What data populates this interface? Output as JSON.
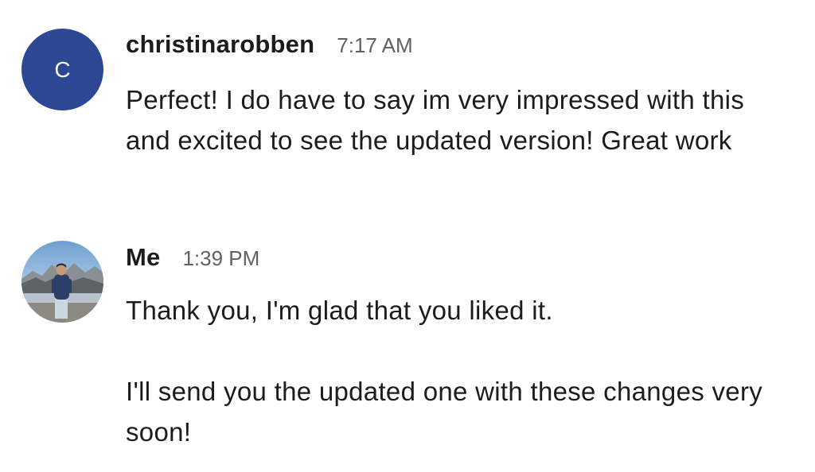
{
  "messages": [
    {
      "avatar_letter": "C",
      "avatar_color": "#2e4795",
      "sender": "christinarobben",
      "time": "7:17 AM",
      "paragraphs": [
        "Perfect! I do have to say im very impressed with this and excited to see the updated version! Great work"
      ]
    },
    {
      "avatar_icon": "user-photo-avatar",
      "sender": "Me",
      "time": "1:39 PM",
      "paragraphs": [
        "Thank you, I'm glad that you liked it.",
        "I'll send you the updated one with these changes very soon!"
      ]
    }
  ]
}
